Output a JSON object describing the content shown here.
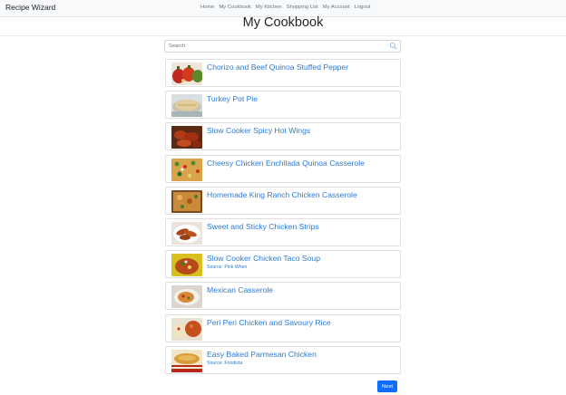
{
  "navbar": {
    "brand": "Recipe Wizard",
    "links": [
      "Home",
      "My Cookbook",
      "My Kitchen",
      "Shopping List",
      "My Account",
      "Logout"
    ]
  },
  "page": {
    "title": "My Cookbook"
  },
  "search": {
    "placeholder": "Search",
    "value": "",
    "icon": "search-icon"
  },
  "recipes": [
    {
      "name": "Chorizo and Beef Quinoa Stuffed Pepper",
      "source": "",
      "thumb_icon": "stuffed-pepper-photo"
    },
    {
      "name": "Turkey Pot Pie",
      "source": "",
      "thumb_icon": "pot-pie-photo"
    },
    {
      "name": "Slow Cooker Spicy Hot Wings",
      "source": "",
      "thumb_icon": "hot-wings-photo"
    },
    {
      "name": "Cheesy Chicken Enchilada Quinoa Casserole",
      "source": "",
      "thumb_icon": "enchilada-casserole-photo"
    },
    {
      "name": "Homemade King Ranch Chicken Casserole",
      "source": "",
      "thumb_icon": "king-ranch-casserole-photo"
    },
    {
      "name": "Sweet and Sticky Chicken Strips",
      "source": "",
      "thumb_icon": "chicken-strips-photo"
    },
    {
      "name": "Slow Cooker Chicken Taco Soup",
      "source": "Source: Pink When",
      "thumb_icon": "taco-soup-photo"
    },
    {
      "name": "Mexican Casserole",
      "source": "",
      "thumb_icon": "mexican-casserole-photo"
    },
    {
      "name": "Peri Peri Chicken and Savoury Rice",
      "source": "",
      "thumb_icon": "peri-peri-chicken-photo"
    },
    {
      "name": "Easy Baked Parmesan Chicken",
      "source": "Source: Foodista",
      "thumb_icon": "parmesan-chicken-photo"
    }
  ],
  "pagination": {
    "next_label": "Next"
  },
  "colors": {
    "link": "#2b7bd6",
    "primary_button": "#0d6efd",
    "navbar_bg": "#f8f9fa"
  }
}
